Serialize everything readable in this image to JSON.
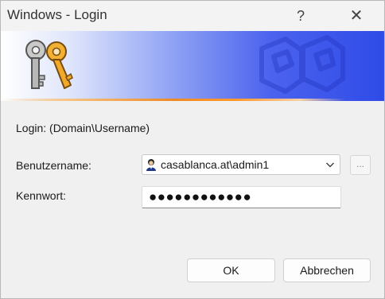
{
  "window": {
    "title": "Windows - Login",
    "help_label": "?",
    "close_label": "✕"
  },
  "banner": {
    "icon": "keys-icon",
    "watermark": "network-watermark-icon",
    "colors": {
      "gradient_start": "#ffffff",
      "gradient_end": "#2f4be8",
      "accent_line": "#ee8a24"
    }
  },
  "form": {
    "login_hint": "Login: (Domain\\Username)",
    "username_label": "Benutzername:",
    "username_value": "casablanca.at\\admin1",
    "username_icon": "user-icon",
    "browse_label": "...",
    "password_label": "Kennwort:",
    "password_masked": "●●●●●●●●●●●●"
  },
  "buttons": {
    "ok": "OK",
    "cancel": "Abbrechen"
  }
}
